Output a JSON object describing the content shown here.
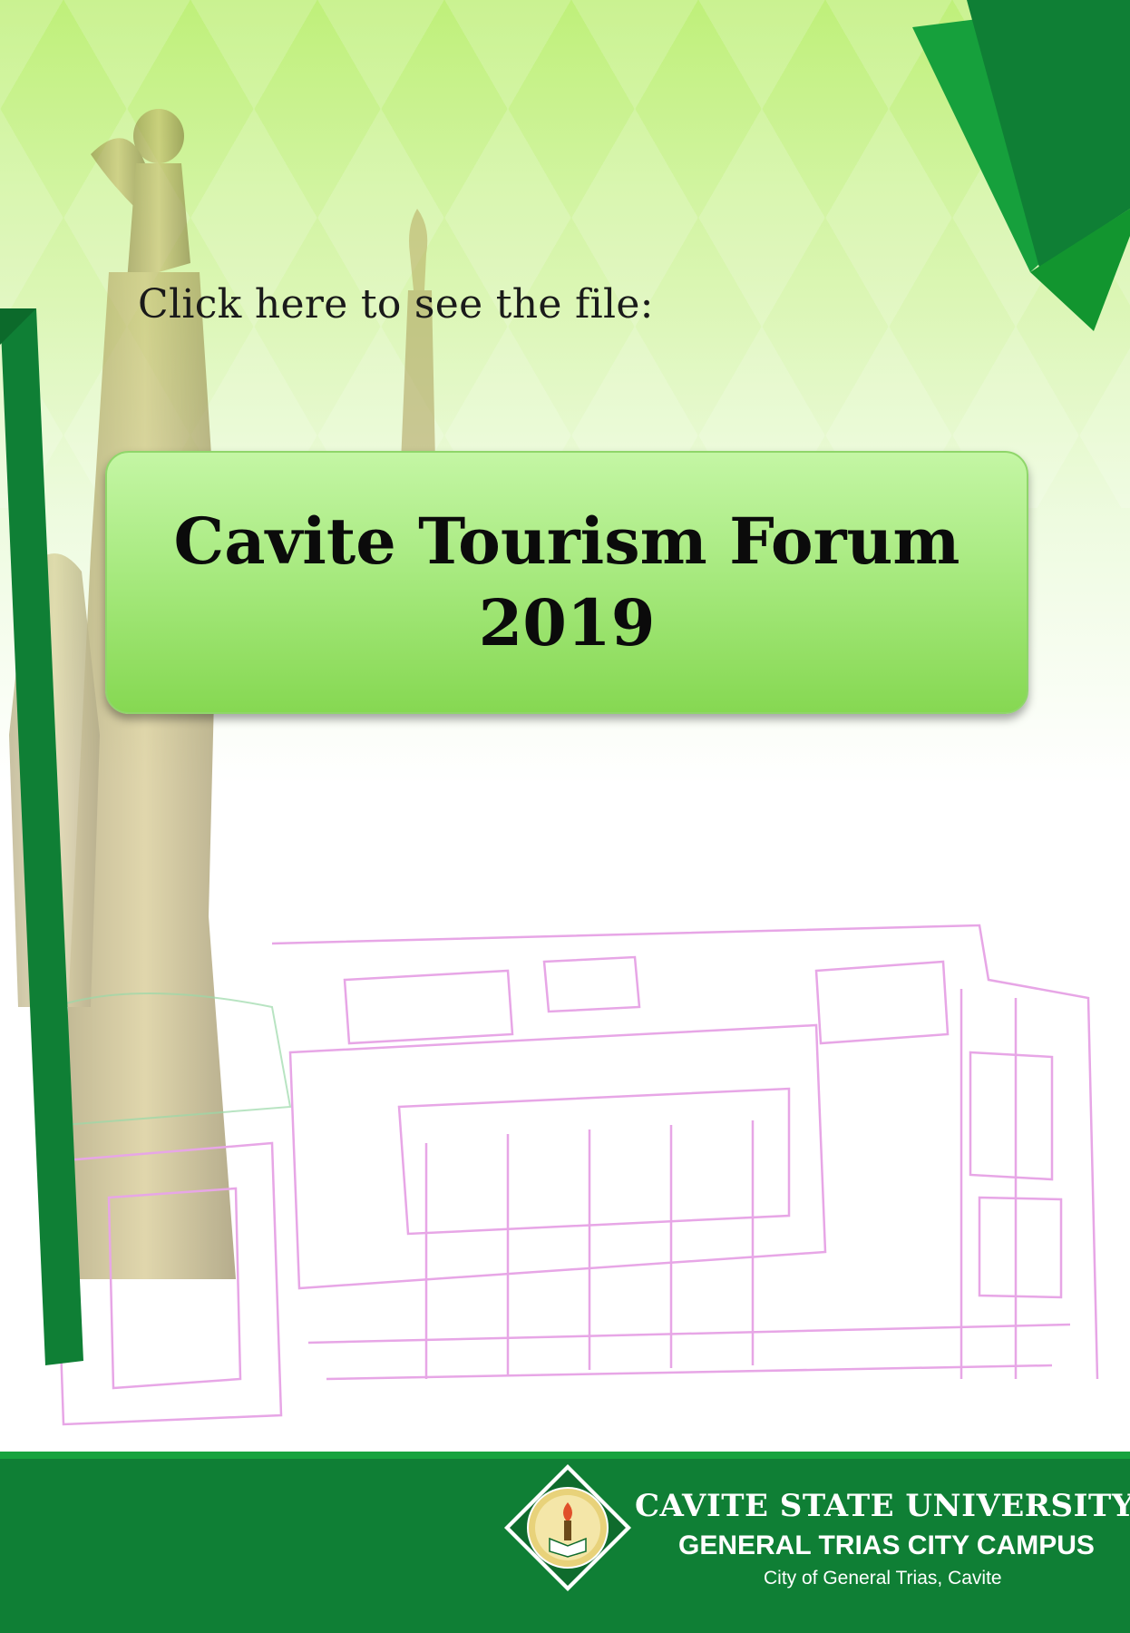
{
  "page": {
    "link_caption": "Click here to see the file:",
    "title_line1": "Cavite Tourism Forum",
    "title_line2": "2019"
  },
  "footer": {
    "university": "CAVITE STATE UNIVERSITY",
    "campus": "GENERAL TRIAS CITY CAMPUS",
    "city": "City of General Trias, Cavite",
    "seal_icon": "university-seal-icon"
  },
  "colors": {
    "dark_green": "#0f7f35",
    "bright_green": "#17a33f",
    "button_top": "#c4f6a4",
    "button_bottom": "#86d852",
    "building_outline": "#e7a6e6"
  }
}
